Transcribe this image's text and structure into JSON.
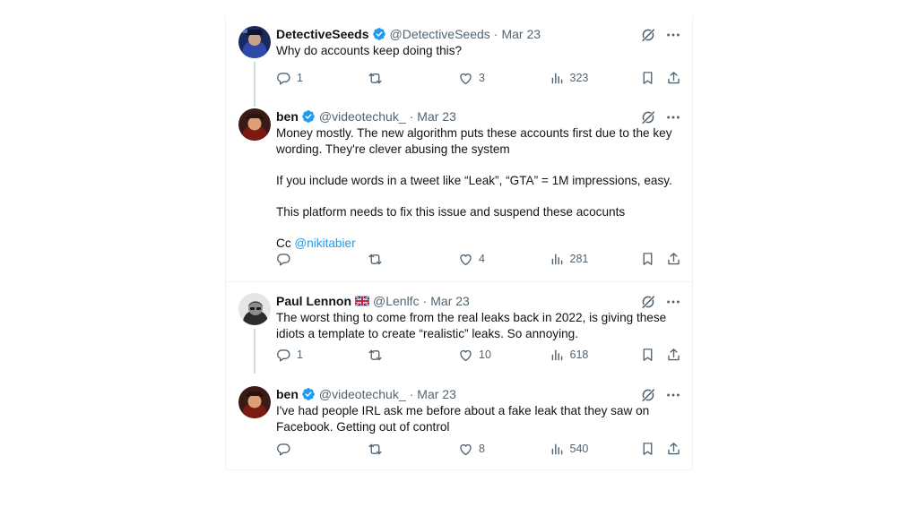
{
  "tweets": [
    {
      "name": "DetectiveSeeds",
      "handle": "@DetectiveSeeds",
      "date": "Mar 23",
      "verified": true,
      "lines": [
        "Why do accounts keep doing this?"
      ],
      "replies": "1",
      "retweets": "",
      "likes": "3",
      "views": "323"
    },
    {
      "name": "ben",
      "handle": "@videotechuk_",
      "date": "Mar 23",
      "verified": true,
      "lines": [
        "Money mostly. The new algorithm puts these accounts first due to the key",
        "wording. They're clever abusing the system",
        "If you include words in a tweet like “Leak”, “GTA” = 1M impressions, easy.",
        "This platform needs to fix this issue and suspend these acocunts",
        "Cc "
      ],
      "mention": "@nikitabier",
      "replies": "",
      "retweets": "",
      "likes": "4",
      "views": "281"
    },
    {
      "name": "Paul Lennon",
      "handle": "@Lenlfc",
      "date": "Mar 23",
      "verified": false,
      "flag": "uk-flag",
      "lines": [
        "The worst thing to come from the real leaks back in 2022, is giving these",
        "idiots a template to create “realistic” leaks. So annoying."
      ],
      "replies": "1",
      "retweets": "",
      "likes": "10",
      "views": "618"
    },
    {
      "name": "ben",
      "handle": "@videotechuk_",
      "date": "Mar 23",
      "verified": true,
      "lines": [
        "I've had people IRL ask me before about a fake leak that they saw on",
        "Facebook. Getting out of control"
      ],
      "replies": "",
      "retweets": "",
      "likes": "8",
      "views": "540"
    }
  ],
  "separator": "·",
  "colors": {
    "accent": "#1d9bf0",
    "secondary_text": "#536471",
    "border": "#eff3f4"
  },
  "icons": [
    "verified-badge-icon",
    "grok-icon",
    "more-icon",
    "reply-icon",
    "retweet-icon",
    "like-icon",
    "views-icon",
    "bookmark-icon",
    "share-icon"
  ]
}
